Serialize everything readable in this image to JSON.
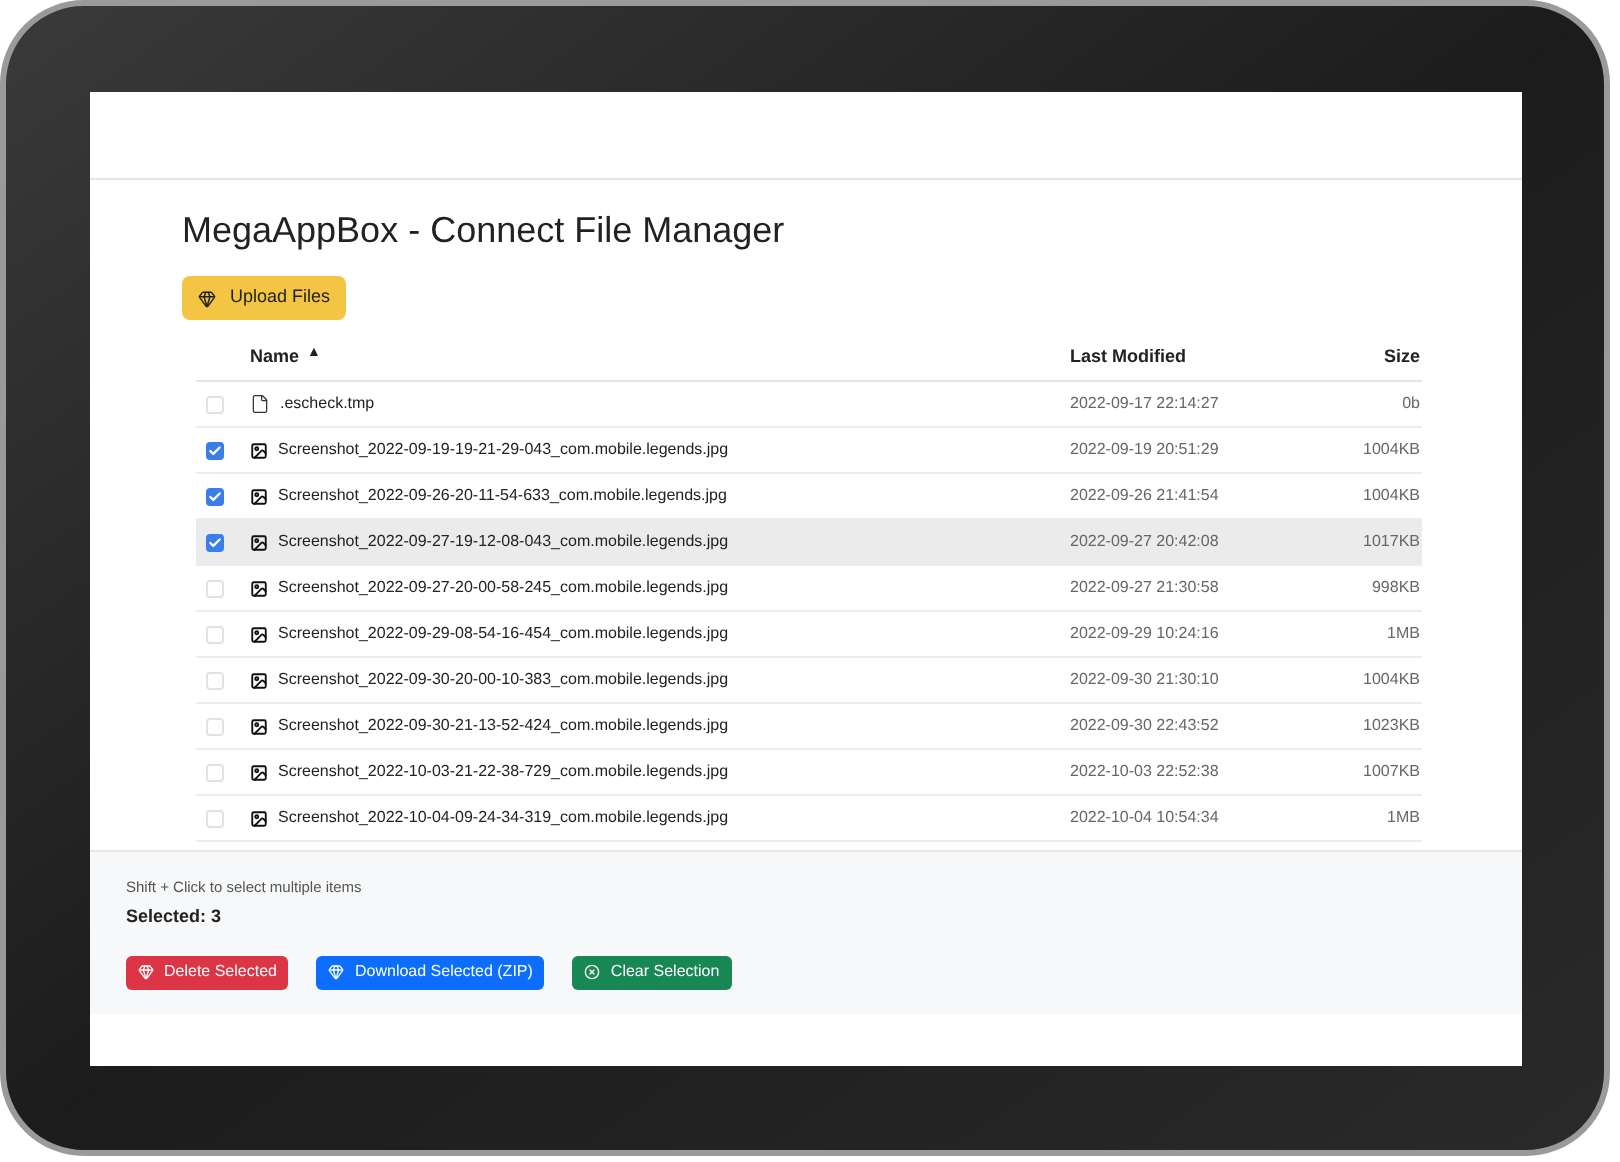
{
  "title": "MegaAppBox - Connect File Manager",
  "upload_button": {
    "label": "Upload Files"
  },
  "table": {
    "columns": [
      {
        "label": "Name",
        "sort": "▲"
      },
      {
        "label": "Last Modified"
      },
      {
        "label": "Size"
      }
    ],
    "rows": [
      {
        "kind": "file",
        "name": ".escheck.tmp",
        "modified": "2022-09-17 22:14:27",
        "size": "0b",
        "checked": false,
        "hovered": false
      },
      {
        "kind": "image",
        "name": "Screenshot_2022-09-19-19-21-29-043_com.mobile.legends.jpg",
        "modified": "2022-09-19 20:51:29",
        "size": "1004KB",
        "checked": true,
        "hovered": false
      },
      {
        "kind": "image",
        "name": "Screenshot_2022-09-26-20-11-54-633_com.mobile.legends.jpg",
        "modified": "2022-09-26 21:41:54",
        "size": "1004KB",
        "checked": true,
        "hovered": false
      },
      {
        "kind": "image",
        "name": "Screenshot_2022-09-27-19-12-08-043_com.mobile.legends.jpg",
        "modified": "2022-09-27 20:42:08",
        "size": "1017KB",
        "checked": true,
        "hovered": true
      },
      {
        "kind": "image",
        "name": "Screenshot_2022-09-27-20-00-58-245_com.mobile.legends.jpg",
        "modified": "2022-09-27 21:30:58",
        "size": "998KB",
        "checked": false,
        "hovered": false
      },
      {
        "kind": "image",
        "name": "Screenshot_2022-09-29-08-54-16-454_com.mobile.legends.jpg",
        "modified": "2022-09-29 10:24:16",
        "size": "1MB",
        "checked": false,
        "hovered": false
      },
      {
        "kind": "image",
        "name": "Screenshot_2022-09-30-20-00-10-383_com.mobile.legends.jpg",
        "modified": "2022-09-30 21:30:10",
        "size": "1004KB",
        "checked": false,
        "hovered": false
      },
      {
        "kind": "image",
        "name": "Screenshot_2022-09-30-21-13-52-424_com.mobile.legends.jpg",
        "modified": "2022-09-30 22:43:52",
        "size": "1023KB",
        "checked": false,
        "hovered": false
      },
      {
        "kind": "image",
        "name": "Screenshot_2022-10-03-21-22-38-729_com.mobile.legends.jpg",
        "modified": "2022-10-03 22:52:38",
        "size": "1007KB",
        "checked": false,
        "hovered": false
      },
      {
        "kind": "image",
        "name": "Screenshot_2022-10-04-09-24-34-319_com.mobile.legends.jpg",
        "modified": "2022-10-04 10:54:34",
        "size": "1MB",
        "checked": false,
        "hovered": false
      }
    ]
  },
  "footer": {
    "hint": "Shift + Click to select multiple items",
    "selected_count": "Selected: 3",
    "buttons": [
      {
        "kind": "danger",
        "label": "Delete Selected"
      },
      {
        "kind": "primary",
        "label": "Download Selected (ZIP)"
      },
      {
        "kind": "success",
        "label": "Clear Selection"
      }
    ]
  }
}
